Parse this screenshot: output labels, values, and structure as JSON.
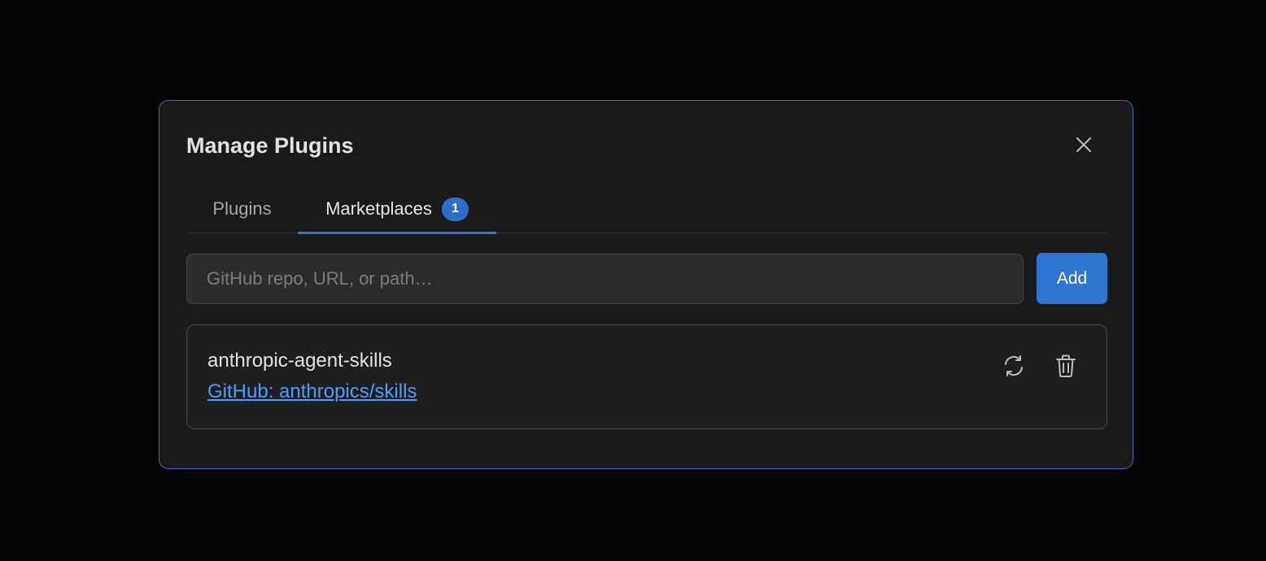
{
  "dialog": {
    "title": "Manage Plugins",
    "close_icon": "close-icon"
  },
  "tabs": [
    {
      "label": "Plugins",
      "active": false
    },
    {
      "label": "Marketplaces",
      "active": true,
      "badge": "1"
    }
  ],
  "add_source": {
    "placeholder": "GitHub repo, URL, or path…",
    "value": "",
    "button_label": "Add"
  },
  "marketplaces": [
    {
      "name": "anthropic-agent-skills",
      "source_link": "GitHub: anthropics/skills",
      "actions": [
        "refresh-icon",
        "trash-icon"
      ]
    }
  ],
  "colors": {
    "accent": "#2f74d0",
    "link": "#4a9eff",
    "dialog_border": "#3b6fb3",
    "dialog_bg": "#1a1a1a",
    "page_bg": "#050505"
  }
}
